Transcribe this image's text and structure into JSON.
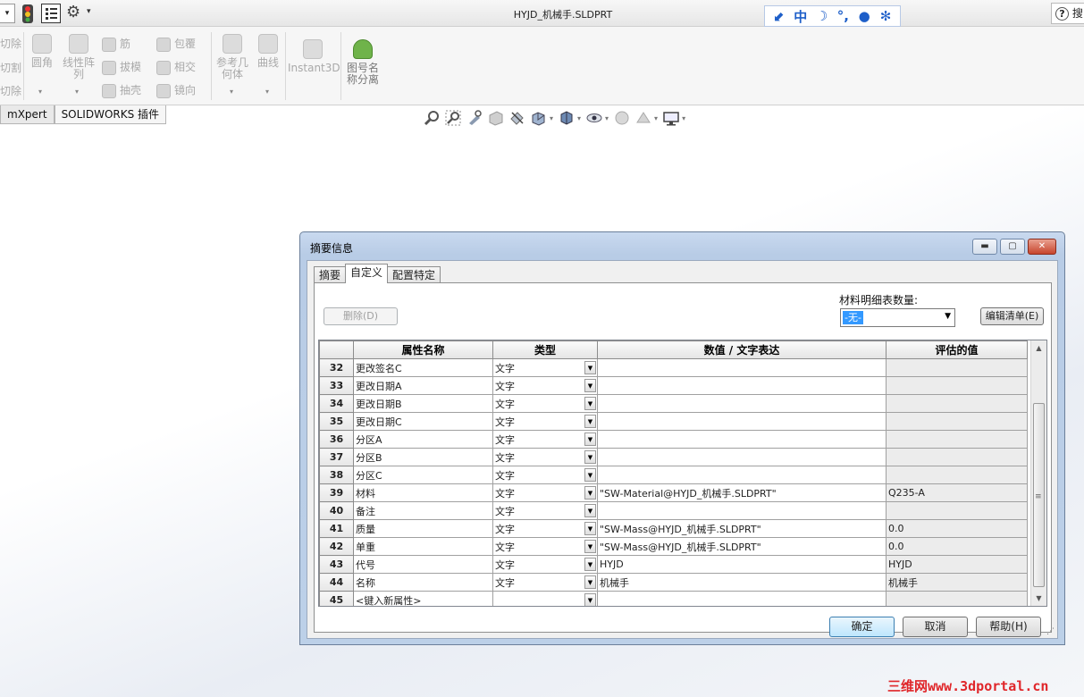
{
  "titlebar": {
    "document_title": "HYJD_机械手.SLDPRT",
    "search_fragment": "搜"
  },
  "ime": {
    "items": [
      "中"
    ]
  },
  "ribbon": {
    "left_cut": [
      "切除",
      "切割",
      "切除"
    ],
    "fillet": "圆角",
    "pattern": [
      "线性阵",
      "列"
    ],
    "rib": "筋",
    "draft": "拔模",
    "shell": "抽壳",
    "wrap": "包覆",
    "intersect": "相交",
    "mirror": "镜向",
    "ref_geom": [
      "参考几",
      "何体"
    ],
    "curves": "曲线",
    "instant3d": "Instant3D",
    "drawing_split": [
      "图号名",
      "称分离"
    ]
  },
  "command_tabs": [
    "mXpert",
    "SOLIDWORKS 插件"
  ],
  "dialog": {
    "title": "摘要信息",
    "tabs": [
      "摘要",
      "自定义",
      "配置特定"
    ],
    "active_tab": "自定义",
    "delete_button": "删除(D)",
    "bom_qty_label": "材料明细表数量:",
    "bom_qty_value": "-无-",
    "edit_list_button": "编辑清单(E)",
    "columns": [
      "属性名称",
      "类型",
      "数值 / 文字表达",
      "评估的值"
    ],
    "rows": [
      {
        "num": "32",
        "name": "更改签名C",
        "type": "文字",
        "value": "",
        "eval": ""
      },
      {
        "num": "33",
        "name": "更改日期A",
        "type": "文字",
        "value": "",
        "eval": ""
      },
      {
        "num": "34",
        "name": "更改日期B",
        "type": "文字",
        "value": "",
        "eval": ""
      },
      {
        "num": "35",
        "name": "更改日期C",
        "type": "文字",
        "value": "",
        "eval": ""
      },
      {
        "num": "36",
        "name": "分区A",
        "type": "文字",
        "value": "",
        "eval": ""
      },
      {
        "num": "37",
        "name": "分区B",
        "type": "文字",
        "value": "",
        "eval": ""
      },
      {
        "num": "38",
        "name": "分区C",
        "type": "文字",
        "value": "",
        "eval": ""
      },
      {
        "num": "39",
        "name": "材料",
        "type": "文字",
        "value": "\"SW-Material@HYJD_机械手.SLDPRT\"",
        "eval": "Q235-A"
      },
      {
        "num": "40",
        "name": "备注",
        "type": "文字",
        "value": "",
        "eval": ""
      },
      {
        "num": "41",
        "name": "质量",
        "type": "文字",
        "value": "\"SW-Mass@HYJD_机械手.SLDPRT\"",
        "eval": "0.0"
      },
      {
        "num": "42",
        "name": "单重",
        "type": "文字",
        "value": "\"SW-Mass@HYJD_机械手.SLDPRT\"",
        "eval": "0.0"
      },
      {
        "num": "43",
        "name": "代号",
        "type": "文字",
        "value": "HYJD",
        "eval": "HYJD"
      },
      {
        "num": "44",
        "name": "名称",
        "type": "文字",
        "value": "机械手",
        "eval": "机械手"
      },
      {
        "num": "45",
        "name": "<键入新属性>",
        "type": "",
        "value": "",
        "eval": ""
      }
    ],
    "ok_button": "确定",
    "cancel_button": "取消",
    "help_button": "帮助(H)"
  },
  "watermark": "三维网www.3dportal.cn"
}
